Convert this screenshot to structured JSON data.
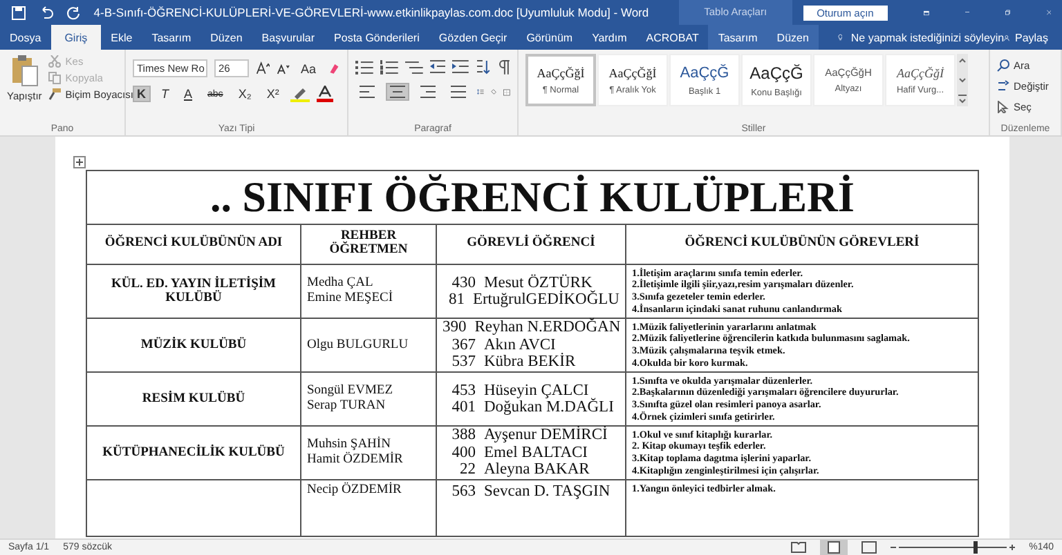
{
  "title_bar": {
    "title": "4-B-Sınıfı-ÖĞRENCİ-KULÜPLERİ-VE-GÖREVLERİ-www.etkinlikpaylas.com.doc [Uyumluluk Modu]  -  Word",
    "tools_label": "Tablo Araçları",
    "sign_in": "Oturum açın"
  },
  "tabs": [
    {
      "label": "Dosya",
      "selected": false,
      "kind": "tab"
    },
    {
      "label": "Giriş",
      "selected": true,
      "kind": "tab"
    },
    {
      "label": "Ekle",
      "selected": false,
      "kind": "tab"
    },
    {
      "label": "Tasarım",
      "selected": false,
      "kind": "tab"
    },
    {
      "label": "Düzen",
      "selected": false,
      "kind": "tab"
    },
    {
      "label": "Başvurular",
      "selected": false,
      "kind": "tab"
    },
    {
      "label": "Posta Gönderileri",
      "selected": false,
      "kind": "tab"
    },
    {
      "label": "Gözden Geçir",
      "selected": false,
      "kind": "tab"
    },
    {
      "label": "Görünüm",
      "selected": false,
      "kind": "tab"
    },
    {
      "label": "Yardım",
      "selected": false,
      "kind": "tab"
    },
    {
      "label": "ACROBAT",
      "selected": false,
      "kind": "tab"
    },
    {
      "label": "Tasarım",
      "selected": false,
      "kind": "context"
    },
    {
      "label": "Düzen",
      "selected": false,
      "kind": "context"
    }
  ],
  "tell_me": "Ne yapmak istediğinizi söyleyin",
  "share": "Paylaş",
  "clipboard": {
    "paste": "Yapıştır",
    "items": [
      {
        "label": "Kes",
        "disabled": true,
        "kind": "cut"
      },
      {
        "label": "Kopyala",
        "disabled": true,
        "kind": "copy"
      },
      {
        "label": "Biçim Boyacısı",
        "disabled": false,
        "kind": "brush"
      }
    ],
    "group": "Pano"
  },
  "font": {
    "family": "Times New Ro",
    "size": "26",
    "case_button": "Aa",
    "buttons": [
      {
        "label": "K",
        "selected": true,
        "kind": "bold"
      },
      {
        "label": "T",
        "selected": false,
        "kind": "italic"
      },
      {
        "label": "A",
        "selected": false,
        "kind": "underline"
      },
      {
        "label": "abc",
        "selected": false,
        "kind": "strike"
      },
      {
        "label": "X₂",
        "selected": false,
        "kind": "plain"
      },
      {
        "label": "X²",
        "selected": false,
        "kind": "plain"
      }
    ],
    "group": "Yazı Tipi"
  },
  "paragraph": {
    "alignment": [
      {
        "selected": false
      },
      {
        "selected": true
      },
      {
        "selected": false
      },
      {
        "selected": false
      }
    ],
    "group": "Paragraf"
  },
  "styles": {
    "items": [
      {
        "sample": "AaÇçĞğİ",
        "label": "¶ Normal",
        "selected": true,
        "kind": "body"
      },
      {
        "sample": "AaÇçĞğİ",
        "label": "¶ Aralık Yok",
        "selected": false,
        "kind": "body"
      },
      {
        "sample": "AaÇçĞ",
        "label": "Başlık 1",
        "selected": false,
        "kind": "heading"
      },
      {
        "sample": "AaÇçĞ",
        "label": "Konu Başlığı",
        "selected": false,
        "kind": "title"
      },
      {
        "sample": "AaÇçĞğH",
        "label": "Altyazı",
        "selected": false,
        "kind": "subtitle"
      },
      {
        "sample": "AaÇçĞğİ",
        "label": "Hafif Vurg...",
        "selected": false,
        "kind": "emphasis"
      }
    ],
    "group": "Stiller"
  },
  "editing": {
    "items": [
      {
        "label": "Ara",
        "kind": "find"
      },
      {
        "label": "Değiştir",
        "kind": "replace"
      },
      {
        "label": "Seç",
        "kind": "select"
      }
    ],
    "group": "Düzenleme"
  },
  "document": {
    "heading": ".. SINIFI ÖĞRENCİ KULÜPLERİ",
    "columns": [
      "ÖĞRENCİ KULÜBÜNÜN ADI",
      "REHBER ÖĞRETMEN",
      "GÖREVLİ ÖĞRENCİ",
      "ÖĞRENCİ KULÜBÜNÜN GÖREVLERİ"
    ],
    "rows": [
      {
        "club": "KÜL. ED. YAYIN İLETİŞİM KULÜBÜ",
        "teachers": [
          "Medha ÇAL",
          "Emine MEŞECİ"
        ],
        "students": [
          {
            "number": "430",
            "name": "Mesut ÖZTÜRK"
          },
          {
            "number": "81",
            "name": "ErtuğrulGEDİKOĞLU"
          }
        ],
        "tasks": [
          "1.İletişim araçlarını sınıfa temin ederler.",
          "2.İletişimle ilgili şiir,yazı,resim yarışmaları düzenler.",
          "3.Sınıfa gezeteler temin ederler.",
          "4.İnsanların içindaki sanat ruhunu canlandırmak"
        ]
      },
      {
        "club": "MÜZİK  KULÜBÜ",
        "teachers": [
          "Olgu BULGURLU"
        ],
        "students": [
          {
            "number": "390",
            "name": "Reyhan N.ERDOĞAN"
          },
          {
            "number": "367",
            "name": "Akın AVCI"
          },
          {
            "number": "537",
            "name": "Kübra BEKİR"
          }
        ],
        "tasks": [
          "1.Müzik faliyetlerinin yararlarını anlatmak",
          "2.Müzik faliyetlerine öğrencilerin katkıda bulunmasını saglamak.",
          "3.Müzik çalışmalarına teşvik etmek.",
          "4.Okulda bir koro kurmak."
        ]
      },
      {
        "club": "RESİM KULÜBÜ",
        "teachers": [
          "Songül EVMEZ",
          "Serap TURAN"
        ],
        "students": [
          {
            "number": "453",
            "name": "Hüseyin ÇALCI"
          },
          {
            "number": "401",
            "name": "Doğukan M.DAĞLI"
          }
        ],
        "tasks": [
          "1.Sınıfta ve okulda yarışmalar düzenlerler.",
          "2.Başkalarının düzenlediği yarışmaları öğrencilere duyururlar.",
          "3.Sınıfta güzel olan resimleri panoya asarlar.",
          "4.Örnek çizimleri sınıfa getirirler."
        ]
      },
      {
        "club": "KÜTÜPHANECİLİK  KULÜBÜ",
        "teachers": [
          "Muhsin ŞAHİN",
          "Hamit ÖZDEMİR"
        ],
        "students": [
          {
            "number": "388",
            "name": "Ayşenur DEMİRCİ"
          },
          {
            "number": "400",
            "name": "Emel BALTACI"
          },
          {
            "number": "22",
            "name": "Aleyna BAKAR"
          }
        ],
        "tasks": [
          "1.Okul ve sınıf kitaplığı kurarlar.",
          "2. Kitap okumayı teşfik ederler.",
          "3.Kitap toplama dagıtma işlerini yaparlar.",
          "4.Kitaplığın zenginleştirilmesi için çalışırlar."
        ]
      },
      {
        "teachers": [
          "Necip ÖZDEMİR"
        ],
        "students": [
          {
            "number": "563",
            "name": "Sevcan D. TAŞGIN"
          }
        ],
        "tasks": [
          "1.Yangın önleyici tedbirler almak."
        ]
      }
    ]
  },
  "status_bar": {
    "page": "Sayfa 1/1",
    "words": "579 sözcük",
    "zoom": "%140",
    "zoom_slider": {
      "level": 0.72
    }
  }
}
